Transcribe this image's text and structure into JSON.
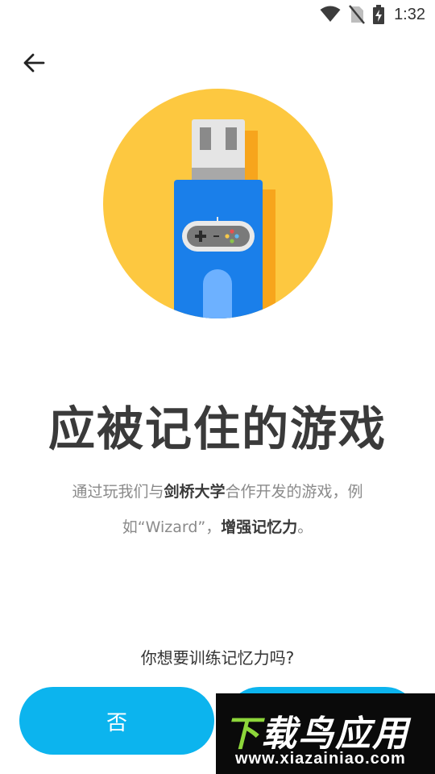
{
  "status_bar": {
    "time": "1:32",
    "icons": [
      "wifi-icon",
      "no-sim-icon",
      "battery-charging-icon"
    ]
  },
  "nav": {
    "back_icon": "arrow-left-icon"
  },
  "hero": {
    "icon": "usb-drive-gamepad-illustration",
    "colors": {
      "circle": "#FDC840",
      "drive_body": "#1A7FEA",
      "drive_shadow": "#F7A51C",
      "connector": "#E5E5E5",
      "arch": "#6DB1FF"
    }
  },
  "main": {
    "title": "应被记住的游戏",
    "description": {
      "p1": "通过玩我们与",
      "b1": "剑桥大学",
      "p2": "合作开发的游戏，例如“Wizard”，",
      "b2": "增强记忆力",
      "p3": "。"
    },
    "question": "你想要训练记忆力吗?"
  },
  "actions": {
    "no_label": "否",
    "accent": "#0CB4EE"
  },
  "watermark": {
    "title_first": "下",
    "title_rest": "载鸟应用",
    "url": "www.xiazainiao.com"
  }
}
